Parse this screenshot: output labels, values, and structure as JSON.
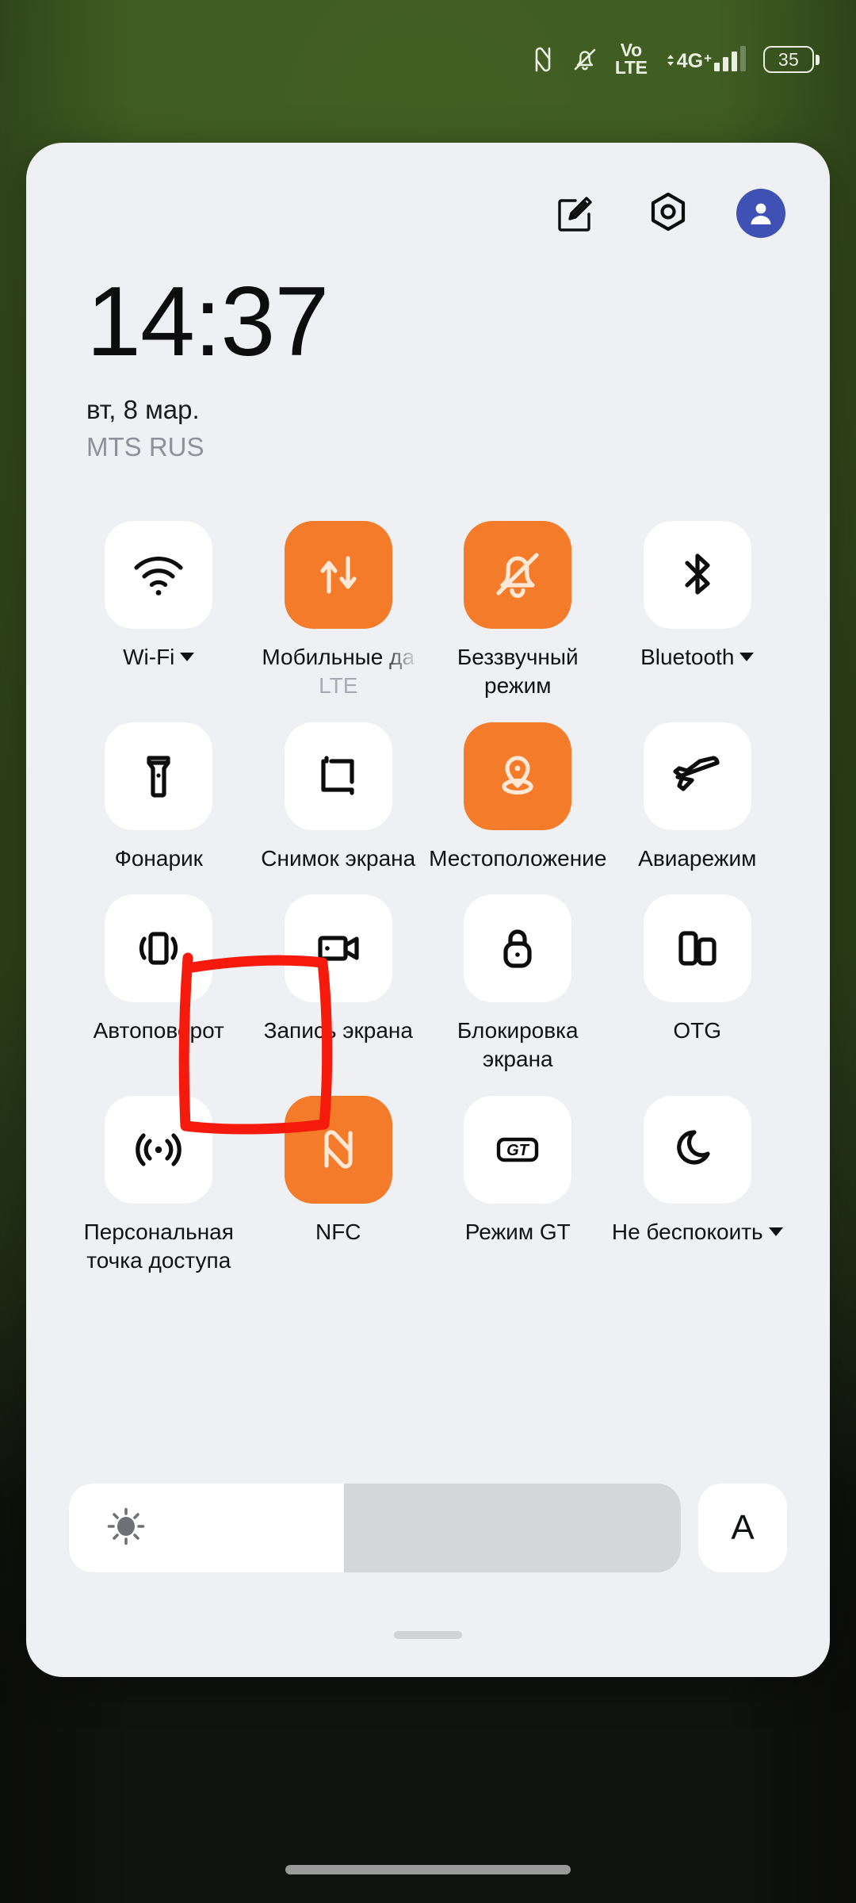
{
  "statusbar": {
    "icons": [
      "nfc-icon",
      "bell-muted-icon",
      "volte-icon",
      "signal-4gplus-icon"
    ],
    "volte_top": "Vo",
    "volte_bottom": "LTE",
    "network": "4G",
    "network_sup": "+",
    "battery_level": "35"
  },
  "header": {
    "edit_label": "edit-icon",
    "settings_label": "gear-icon",
    "account_label": "user-avatar"
  },
  "clock": {
    "time": "14:37",
    "date": "вт, 8 мар.",
    "carrier": "MTS RUS"
  },
  "tiles": [
    {
      "id": "wifi",
      "label": "Wi-Fi",
      "sub": "",
      "active": false,
      "caret": true,
      "icon": "wifi-icon",
      "truncate": false
    },
    {
      "id": "mobile-data",
      "label": "Мобильные да",
      "sub": "LTE",
      "active": true,
      "caret": false,
      "icon": "data-transfer-icon",
      "truncate": true
    },
    {
      "id": "silent",
      "label": "Беззвучный режим",
      "sub": "",
      "active": true,
      "caret": false,
      "icon": "bell-muted-icon",
      "truncate": false
    },
    {
      "id": "bluetooth",
      "label": "Bluetooth",
      "sub": "",
      "active": false,
      "caret": true,
      "icon": "bluetooth-icon",
      "truncate": false
    },
    {
      "id": "flashlight",
      "label": "Фонарик",
      "sub": "",
      "active": false,
      "caret": false,
      "icon": "flashlight-icon",
      "truncate": false
    },
    {
      "id": "screenshot",
      "label": "Снимок экрана",
      "sub": "",
      "active": false,
      "caret": false,
      "icon": "crop-icon",
      "truncate": false
    },
    {
      "id": "location",
      "label": "Местоположение",
      "sub": "",
      "active": true,
      "caret": false,
      "icon": "location-pin-icon",
      "truncate": false
    },
    {
      "id": "airplane",
      "label": "Авиарежим",
      "sub": "",
      "active": false,
      "caret": false,
      "icon": "airplane-icon",
      "truncate": false
    },
    {
      "id": "autorotate",
      "label": "Автоповорот",
      "sub": "",
      "active": false,
      "caret": false,
      "icon": "rotate-phone-icon",
      "truncate": false
    },
    {
      "id": "screenrec",
      "label": "Запись экрана",
      "sub": "",
      "active": false,
      "caret": false,
      "icon": "video-record-icon",
      "truncate": false
    },
    {
      "id": "screenlock",
      "label": "Блокировка экрана",
      "sub": "",
      "active": false,
      "caret": false,
      "icon": "lock-icon",
      "truncate": false
    },
    {
      "id": "otg",
      "label": "OTG",
      "sub": "",
      "active": false,
      "caret": false,
      "icon": "otg-icon",
      "truncate": false
    },
    {
      "id": "hotspot",
      "label": "Персональная точка доступа",
      "sub": "",
      "active": false,
      "caret": false,
      "icon": "hotspot-icon",
      "truncate": false
    },
    {
      "id": "nfc",
      "label": "NFC",
      "sub": "",
      "active": true,
      "caret": false,
      "icon": "nfc-icon",
      "truncate": false
    },
    {
      "id": "gt-mode",
      "label": "Режим GT",
      "sub": "",
      "active": false,
      "caret": false,
      "icon": "gt-badge-icon",
      "truncate": false
    },
    {
      "id": "dnd",
      "label": "Не беспокоить",
      "sub": "",
      "active": false,
      "caret": true,
      "icon": "moon-icon",
      "truncate": false
    }
  ],
  "brightness": {
    "icon": "sun-icon",
    "fill_percent": 45,
    "auto_label": "A"
  },
  "annotation": {
    "shape": "hand-drawn-red-rectangle",
    "target": "nfc",
    "color": "#f61a0d"
  },
  "colors": {
    "accent_on": "#f47b2a",
    "panel_bg": "#eef0f4",
    "tile_bg": "#ffffff",
    "avatar_bg": "#3f51b5",
    "wallpaper": "#3e5a22",
    "annotation_red": "#f61a0d"
  }
}
